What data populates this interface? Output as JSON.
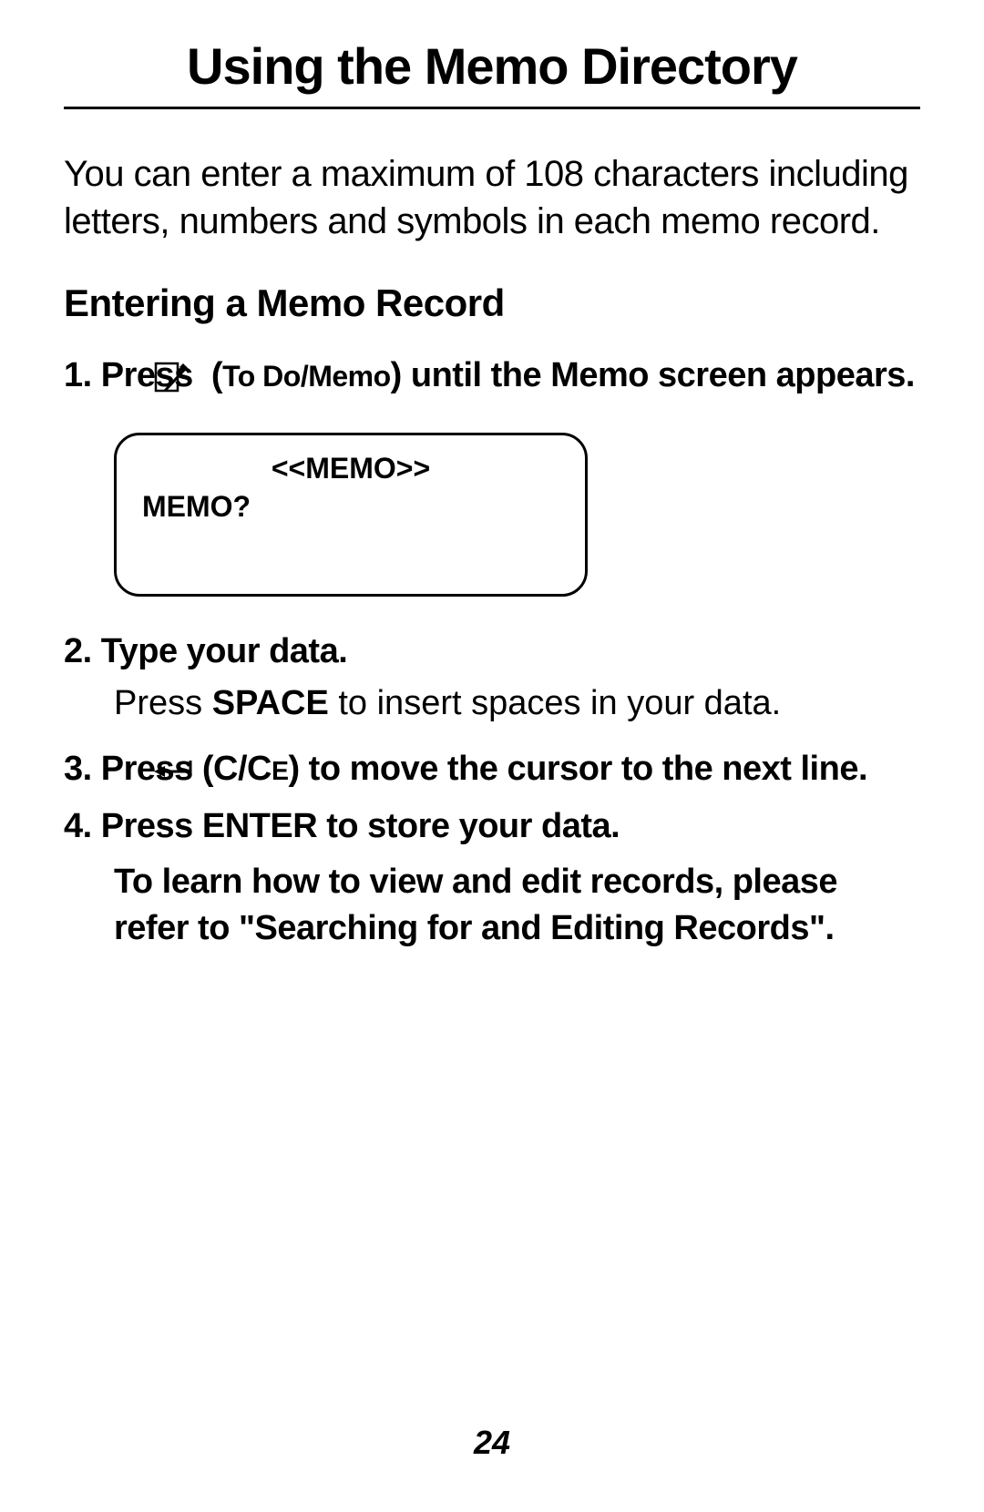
{
  "title": "Using the Memo Directory",
  "intro": "You can enter a maximum of 108 characters including letters, numbers and symbols in each memo record.",
  "sectionTitle": "Entering a Memo Record",
  "step1": {
    "prefix": "1. Press ",
    "todoLabel": "To Do/Memo",
    "suffix": ") until the Memo screen appears."
  },
  "screen": {
    "line1": "<<MEMO>>",
    "line2": "MEMO?"
  },
  "step2": "2. Type your data.",
  "step2sub_prefix": "Press ",
  "step2sub_bold": "SPACE",
  "step2sub_suffix": " to insert spaces in your data.",
  "step3": {
    "prefix": "3. Press ",
    "cce_prefix": "(C/C",
    "cce_e": "E",
    "cce_suffix": ")",
    "suffix": " to move the cursor to the next line."
  },
  "step4": "4. Press ENTER to store your data.",
  "note": "To learn how to view and edit records, please refer to \"Searching for and Editing Records\".",
  "pageNumber": "24"
}
